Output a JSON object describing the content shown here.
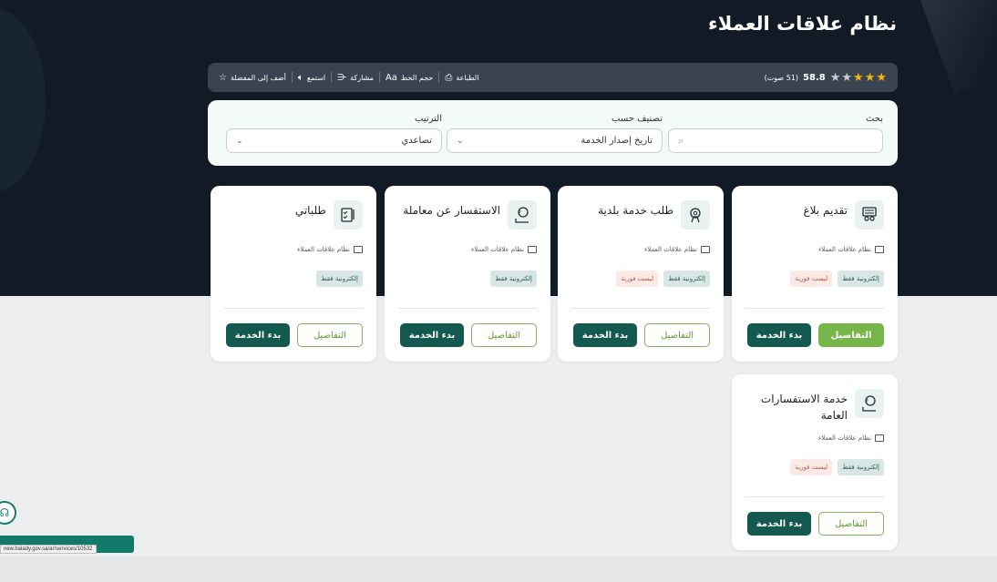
{
  "page": {
    "title": "نظام علاقات العملاء"
  },
  "rating": {
    "value": "58.8",
    "count": "(51 صوت)",
    "stars": [
      true,
      true,
      true,
      false,
      false
    ],
    "star_on_color": "#f5b50a"
  },
  "tools": {
    "favorite": "أضف إلى المفضلة",
    "listen": "استمع",
    "share": "مشاركة",
    "font_size": "حجم الخط",
    "print": "الطباعة"
  },
  "filters": {
    "search_label": "بحث",
    "search_value": "",
    "sort_by_label": "تصنيف حسب",
    "sort_by_value": "تاريخ إصدار الخدمة",
    "order_label": "الترتيب",
    "order_value": "تصاعدي"
  },
  "cards": [
    {
      "title": "تقديم بلاغ",
      "icon": "report-icon",
      "system": "نظام علاقات العملاء",
      "tags": [
        "إلكترونية فقط",
        "ليست فورية"
      ],
      "details": "التفاصيل",
      "start": "بدء الخدمة"
    },
    {
      "title": "طلب خدمة بلدية",
      "icon": "service-request-icon",
      "system": "نظام علاقات العملاء",
      "tags": [
        "إلكترونية فقط",
        "ليست فورية"
      ],
      "details": "التفاصيل",
      "start": "بدء الخدمة"
    },
    {
      "title": "الاستفسار عن معاملة",
      "icon": "inquiry-icon",
      "system": "نظام علاقات العملاء",
      "tags": [
        "إلكترونية فقط"
      ],
      "details": "التفاصيل",
      "start": "بدء الخدمة"
    },
    {
      "title": "طلباتي",
      "icon": "my-requests-icon",
      "system": "نظام علاقات العملاء",
      "tags": [
        "إلكترونية فقط"
      ],
      "details": "التفاصيل",
      "start": "بدء الخدمة"
    },
    {
      "title": "خدمة الاستفسارات العامة",
      "icon": "inquiry-icon",
      "system": "نظام علاقات العملاء",
      "tags": [
        "إلكترونية فقط",
        "ليست فورية"
      ],
      "details": "التفاصيل",
      "start": "بدء الخدمة"
    }
  ],
  "status_url": "new.balady.gov.sa/ar/services/10532"
}
